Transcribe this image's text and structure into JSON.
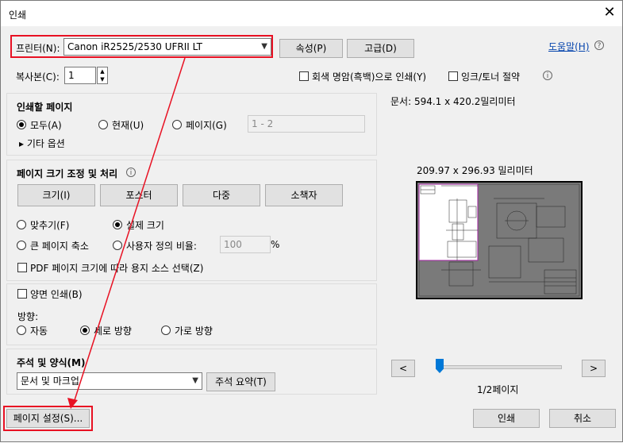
{
  "window": {
    "title": "인쇄",
    "close_glyph": "✕"
  },
  "printer": {
    "label": "프린터(N):",
    "value": "Canon iR2525/2530 UFRII LT",
    "properties": "속성(P)",
    "advanced": "고급(D)",
    "help": "도움말(H)",
    "help_glyph": "?"
  },
  "copies": {
    "label": "복사본(C):",
    "value": "1",
    "grayscale": "회색 명암(흑백)으로 인쇄(Y)",
    "ink_save": "잉크/토너 절약"
  },
  "pages_to_print": {
    "title": "인쇄할 페이지",
    "all": "모두(A)",
    "current": "현재(U)",
    "pages": "페이지(G)",
    "range_placeholder": "1 - 2",
    "more_options": "▸ 기타 옵션"
  },
  "sizing": {
    "title": "페이지 크기 조정 및 처리",
    "size": "크기(I)",
    "poster": "포스터",
    "multiple": "다중",
    "booklet": "소책자",
    "fit": "맞추기(F)",
    "actual": "실제 크기",
    "shrink": "큰 페이지 축소",
    "custom": "사용자 정의 비율:",
    "scale_value": "100",
    "percent": "%",
    "pdf_source": "PDF 페이지 크기에 따라 용지 소스 선택(Z)"
  },
  "duplex": {
    "label": "양면 인쇄(B)"
  },
  "orientation": {
    "label": "방향:",
    "auto": "자동",
    "portrait": "세로 방향",
    "landscape": "가로 방향"
  },
  "comments": {
    "title": "주석 및 양식(M)",
    "value": "문서 및 마크업",
    "summary": "주석 요약(T)"
  },
  "preview": {
    "doc_size": "문서: 594.1 x 420.2밀리미터",
    "paper_size": "209.97 x 296.93 밀리미터",
    "page_info": "1/2페이지",
    "prev": "<",
    "next": ">"
  },
  "footer": {
    "page_setup": "페이지 설정(S)...",
    "print": "인쇄",
    "cancel": "취소"
  },
  "colors": {
    "highlight": "#e81123",
    "preview_bg": "#808080",
    "link": "#0645ad"
  }
}
